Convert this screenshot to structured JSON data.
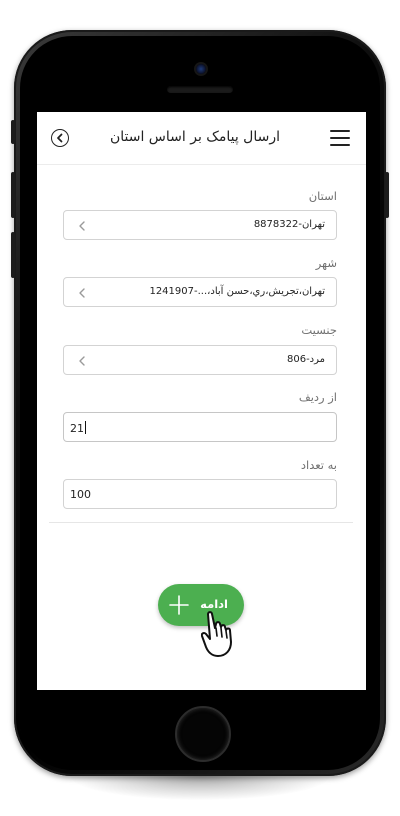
{
  "app": {
    "title": "ارسال پیامک بر اساس استان"
  },
  "form": {
    "province": {
      "label": "استان",
      "value": "تهران-8878322"
    },
    "city": {
      "label": "شهر",
      "value": "تهران،تجريش،ري،حسن آباد،...-1241907"
    },
    "gender": {
      "label": "جنسیت",
      "value": "مرد-806"
    },
    "from_row": {
      "label": "از ردیف",
      "value": "21"
    },
    "count": {
      "label": "به تعداد",
      "value": "100"
    }
  },
  "actions": {
    "continue_label": "ادامه"
  },
  "icons": {
    "menu": "hamburger-menu-icon",
    "back": "back-arrow-circle-icon",
    "select": "chevron-left-icon",
    "plus": "plus-icon",
    "pointer": "pointing-hand-icon"
  },
  "colors": {
    "primary": "#4caf50",
    "text": "#222222",
    "muted": "#707070",
    "border": "#d3d3d3"
  }
}
